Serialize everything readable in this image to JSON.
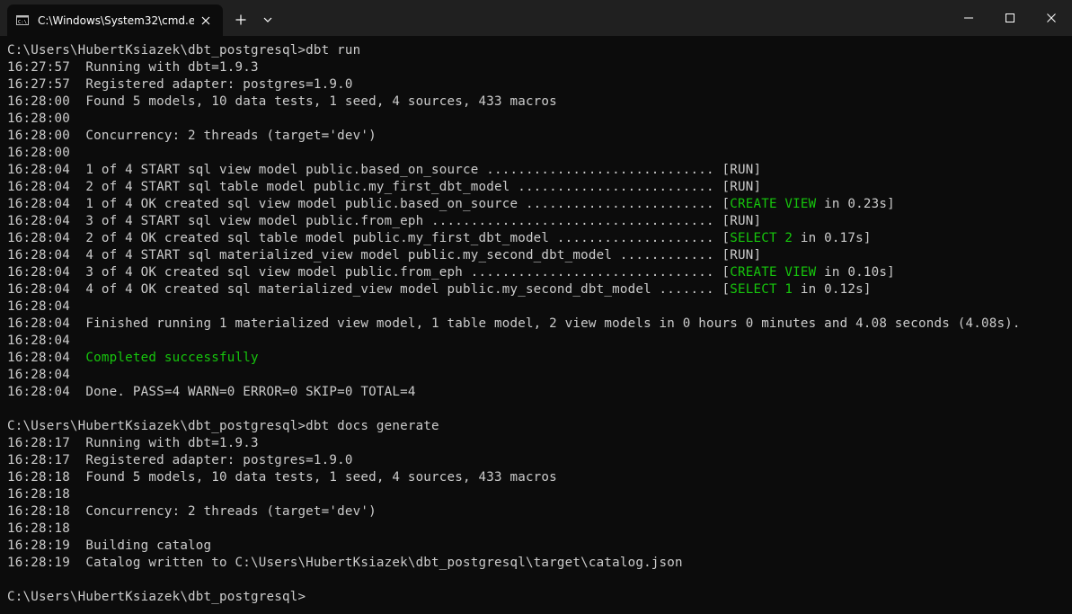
{
  "tab": {
    "title": "C:\\Windows\\System32\\cmd.e"
  },
  "colors": {
    "titlebar": "#202020",
    "terminal_bg": "#0c0c0c",
    "text": "#cccccc",
    "success_green": "#16c60c"
  },
  "icons": {
    "tab_icon": "cmd-icon",
    "close_tab": "close-icon",
    "new_tab": "plus-icon",
    "dropdown": "chevron-down-icon",
    "minimize": "minimize-icon",
    "maximize": "maximize-icon",
    "close": "close-icon"
  },
  "terminal": {
    "lines": [
      {
        "segments": [
          {
            "text": "C:\\Users\\HubertKsiazek\\dbt_postgresql>dbt run"
          }
        ]
      },
      {
        "segments": [
          {
            "text": "16:27:57  Running with dbt=1.9.3"
          }
        ]
      },
      {
        "segments": [
          {
            "text": "16:27:57  Registered adapter: postgres=1.9.0"
          }
        ]
      },
      {
        "segments": [
          {
            "text": "16:28:00  Found 5 models, 10 data tests, 1 seed, 4 sources, 433 macros"
          }
        ]
      },
      {
        "segments": [
          {
            "text": "16:28:00"
          }
        ]
      },
      {
        "segments": [
          {
            "text": "16:28:00  Concurrency: 2 threads (target='dev')"
          }
        ]
      },
      {
        "segments": [
          {
            "text": "16:28:00"
          }
        ]
      },
      {
        "segments": [
          {
            "text": "16:28:04  1 of 4 START sql view model public.based_on_source ............................. [RUN]"
          }
        ]
      },
      {
        "segments": [
          {
            "text": "16:28:04  2 of 4 START sql table model public.my_first_dbt_model ......................... [RUN]"
          }
        ]
      },
      {
        "segments": [
          {
            "text": "16:28:04  1 of 4 OK created sql view model public.based_on_source ........................ ["
          },
          {
            "text": "CREATE VIEW",
            "green": true
          },
          {
            "text": " in 0.23s]"
          }
        ]
      },
      {
        "segments": [
          {
            "text": "16:28:04  3 of 4 START sql view model public.from_eph .................................... [RUN]"
          }
        ]
      },
      {
        "segments": [
          {
            "text": "16:28:04  2 of 4 OK created sql table model public.my_first_dbt_model .................... ["
          },
          {
            "text": "SELECT 2",
            "green": true
          },
          {
            "text": " in 0.17s]"
          }
        ]
      },
      {
        "segments": [
          {
            "text": "16:28:04  4 of 4 START sql materialized_view model public.my_second_dbt_model ............ [RUN]"
          }
        ]
      },
      {
        "segments": [
          {
            "text": "16:28:04  3 of 4 OK created sql view model public.from_eph ............................... ["
          },
          {
            "text": "CREATE VIEW",
            "green": true
          },
          {
            "text": " in 0.10s]"
          }
        ]
      },
      {
        "segments": [
          {
            "text": "16:28:04  4 of 4 OK created sql materialized_view model public.my_second_dbt_model ....... ["
          },
          {
            "text": "SELECT 1",
            "green": true
          },
          {
            "text": " in 0.12s]"
          }
        ]
      },
      {
        "segments": [
          {
            "text": "16:28:04"
          }
        ]
      },
      {
        "segments": [
          {
            "text": "16:28:04  Finished running 1 materialized view model, 1 table model, 2 view models in 0 hours 0 minutes and 4.08 seconds (4.08s)."
          }
        ]
      },
      {
        "segments": [
          {
            "text": "16:28:04"
          }
        ]
      },
      {
        "segments": [
          {
            "text": "16:28:04  "
          },
          {
            "text": "Completed successfully",
            "green": true
          }
        ]
      },
      {
        "segments": [
          {
            "text": "16:28:04"
          }
        ]
      },
      {
        "segments": [
          {
            "text": "16:28:04  Done. PASS=4 WARN=0 ERROR=0 SKIP=0 TOTAL=4"
          }
        ]
      },
      {
        "segments": [
          {
            "text": ""
          }
        ]
      },
      {
        "segments": [
          {
            "text": "C:\\Users\\HubertKsiazek\\dbt_postgresql>dbt docs generate"
          }
        ]
      },
      {
        "segments": [
          {
            "text": "16:28:17  Running with dbt=1.9.3"
          }
        ]
      },
      {
        "segments": [
          {
            "text": "16:28:17  Registered adapter: postgres=1.9.0"
          }
        ]
      },
      {
        "segments": [
          {
            "text": "16:28:18  Found 5 models, 10 data tests, 1 seed, 4 sources, 433 macros"
          }
        ]
      },
      {
        "segments": [
          {
            "text": "16:28:18"
          }
        ]
      },
      {
        "segments": [
          {
            "text": "16:28:18  Concurrency: 2 threads (target='dev')"
          }
        ]
      },
      {
        "segments": [
          {
            "text": "16:28:18"
          }
        ]
      },
      {
        "segments": [
          {
            "text": "16:28:19  Building catalog"
          }
        ]
      },
      {
        "segments": [
          {
            "text": "16:28:19  Catalog written to C:\\Users\\HubertKsiazek\\dbt_postgresql\\target\\catalog.json"
          }
        ]
      },
      {
        "segments": [
          {
            "text": ""
          }
        ]
      },
      {
        "segments": [
          {
            "text": "C:\\Users\\HubertKsiazek\\dbt_postgresql>"
          }
        ]
      }
    ]
  }
}
